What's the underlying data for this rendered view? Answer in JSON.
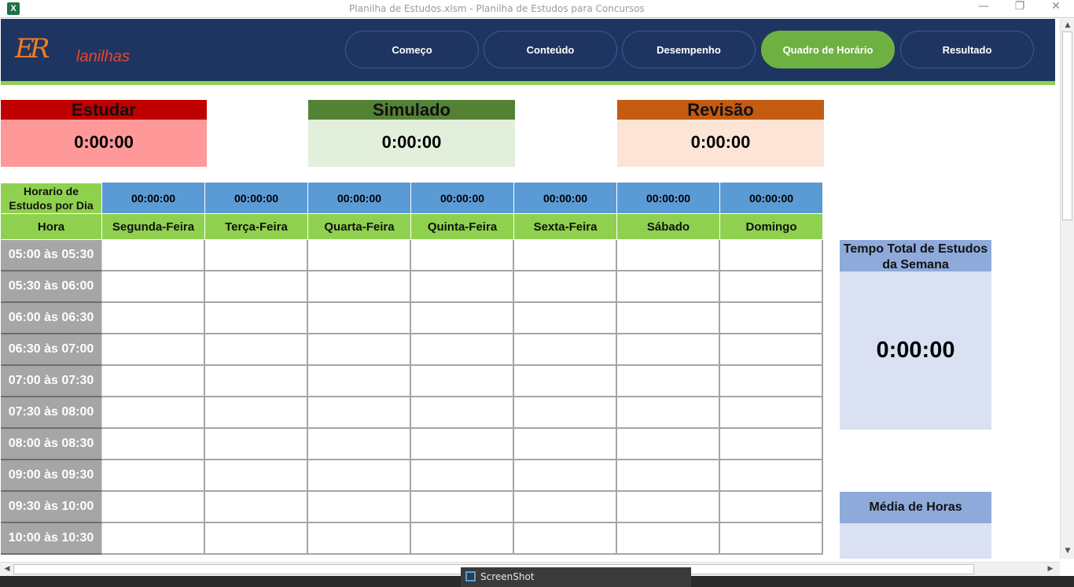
{
  "window": {
    "title": "Planilha de Estudos.xlsm - Planilha de Estudos para Concursos",
    "app_icon": "X",
    "minimize": "—",
    "restore": "❐",
    "close": "✕"
  },
  "logo": {
    "initials": "ER",
    "text": "lanilhas"
  },
  "nav": [
    {
      "label": "Começo",
      "active": false
    },
    {
      "label": "Conteúdo",
      "active": false
    },
    {
      "label": "Desempenho",
      "active": false
    },
    {
      "label": "Quadro de Horário",
      "active": true
    },
    {
      "label": "Resultado",
      "active": false
    }
  ],
  "summary": {
    "estudar": {
      "title": "Estudar",
      "value": "0:00:00",
      "head_color": "#c00000",
      "body_color": "#ff9999"
    },
    "simulado": {
      "title": "Simulado",
      "value": "0:00:00",
      "head_color": "#548235",
      "body_color": "#e2efda"
    },
    "revisao": {
      "title": "Revisão",
      "value": "0:00:00",
      "head_color": "#c55a11",
      "body_color": "#fce4d6"
    }
  },
  "schedule": {
    "daily_label": "Horario de Estudos por Dia",
    "hour_label": "Hora",
    "days": [
      {
        "name": "Segunda-Feira",
        "total": "00:00:00"
      },
      {
        "name": "Terça-Feira",
        "total": "00:00:00"
      },
      {
        "name": "Quarta-Feira",
        "total": "00:00:00"
      },
      {
        "name": "Quinta-Feira",
        "total": "00:00:00"
      },
      {
        "name": "Sexta-Feira",
        "total": "00:00:00"
      },
      {
        "name": "Sábado",
        "total": "00:00:00"
      },
      {
        "name": "Domingo",
        "total": "00:00:00"
      }
    ],
    "slots": [
      "05:00 às 05:30",
      "05:30 às 06:00",
      "06:00 às 06:30",
      "06:30 às 07:00",
      " 07:00 às 07:30",
      "07:30 às 08:00",
      "08:00 às 08:30",
      "09:00 às 09:30",
      "09:30 às 10:00",
      "10:00 às 10:30"
    ]
  },
  "totals": {
    "weekly_title": "Tempo Total de Estudos da Semana",
    "weekly_value": "0:00:00",
    "average_title": "Média de Horas"
  },
  "taskbar": {
    "window_label": "ScreenShot"
  }
}
